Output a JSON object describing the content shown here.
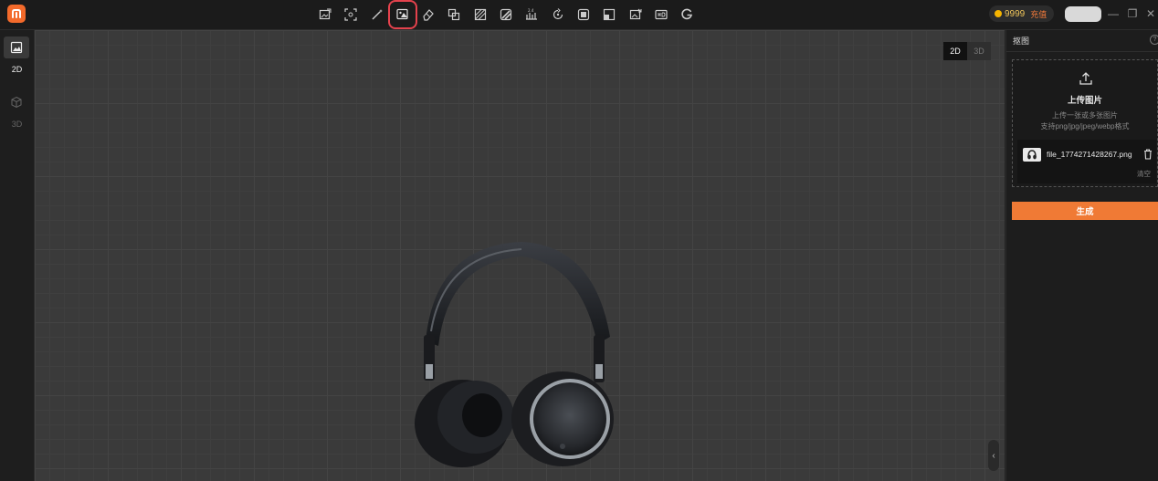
{
  "app": {
    "logo_icon": "app-logo-icon",
    "brand_color": "#f36a2b"
  },
  "toolbar": {
    "tools": [
      {
        "icon": "image-edit-icon"
      },
      {
        "icon": "scan-frame-icon"
      },
      {
        "icon": "magic-wand-icon"
      },
      {
        "icon": "cutout-icon",
        "active": true
      },
      {
        "icon": "eraser-icon"
      },
      {
        "icon": "copy-frame-icon"
      },
      {
        "icon": "texture-icon"
      },
      {
        "icon": "stripes-icon"
      },
      {
        "icon": "upscale-icon"
      },
      {
        "icon": "rotate-icon"
      },
      {
        "icon": "square-frame-icon"
      },
      {
        "icon": "corner-box-icon"
      },
      {
        "icon": "image-export-icon"
      },
      {
        "icon": "hd-icon"
      },
      {
        "icon": "google-icon"
      }
    ],
    "active_outline_color": "#e4424d"
  },
  "account": {
    "coins": "9999",
    "recharge_label": "充值"
  },
  "window": {
    "minimize": "—",
    "restore": "❐",
    "close": "✕"
  },
  "leftrail": {
    "label_2d": "2D",
    "label_3d": "3D"
  },
  "canvas": {
    "toggle_2d": "2D",
    "toggle_3d": "3D",
    "collapse_glyph": "‹"
  },
  "panel": {
    "title": "抠图",
    "help": "?",
    "upload_title": "上传图片",
    "upload_hint_1": "上传一张或多张图片",
    "upload_hint_2": "支持png/jpg/jpeg/webp格式",
    "file_name": "file_1774271428267.png",
    "clear_label": "清空",
    "generate_label": "生成",
    "accent_color": "#f07a35"
  }
}
